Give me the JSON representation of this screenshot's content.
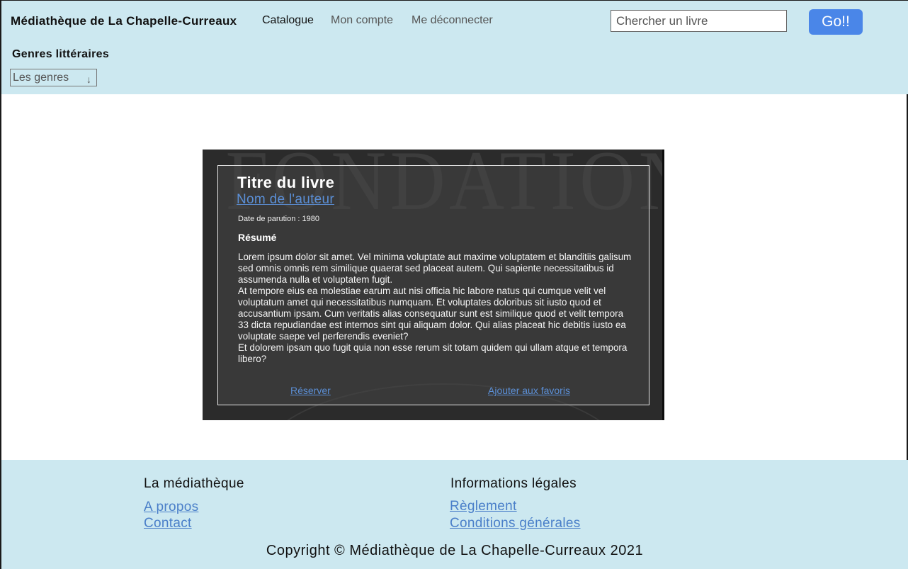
{
  "header": {
    "brand": "Médiathèque de La Chapelle-Curreaux",
    "nav": {
      "catalogue": "Catalogue",
      "account": "Mon compte",
      "logout": "Me déconnecter"
    },
    "search": {
      "placeholder": "Chercher un livre",
      "button_label": "Go!!"
    },
    "genres": {
      "title": "Genres littéraires",
      "select_value": "Les genres",
      "arrow": "↓"
    }
  },
  "book": {
    "cover_text": "FONDATION",
    "title": "Titre du livre",
    "author": "Nom de l'auteur",
    "date": "Date de parution : 1980",
    "summary_title": "Résumé",
    "summary": [
      "Lorem ipsum dolor sit amet. Vel minima voluptate aut maxime voluptatem et blanditiis galisum sed omnis omnis rem similique quaerat sed placeat autem. Qui sapiente necessitatibus id assumenda nulla et voluptatem fugit.",
      "At tempore eius ea molestiae earum aut nisi officia hic labore natus qui cumque velit vel voluptatum amet qui necessitatibus numquam. Et voluptates doloribus sit iusto quod et accusantium ipsam. Cum veritatis alias consequatur sunt est similique quod et velit tempora 33 dicta repudiandae est internos sint qui aliquam dolor. Qui alias placeat hic debitis iusto ea voluptate saepe vel perferendis eveniet?",
      "Et dolorem ipsam quo fugit quia non esse rerum sit totam quidem qui ullam atque et tempora libero?"
    ],
    "reserve_label": "Réserver",
    "favorite_label": "Ajouter aux favoris"
  },
  "footer": {
    "col1": {
      "heading": "La médiathèque",
      "links": [
        "A propos",
        "Contact"
      ]
    },
    "col2": {
      "heading": "Informations légales",
      "links": [
        "Règlement",
        "Conditions générales"
      ]
    },
    "copyright": "Copyright © Médiathèque de La Chapelle-Curreaux 2021"
  },
  "colors": {
    "header_bg": "#cce8f0",
    "button_bg": "#4a86e8",
    "link": "#4a7fc9",
    "card_bg": "#2b2b2b"
  }
}
